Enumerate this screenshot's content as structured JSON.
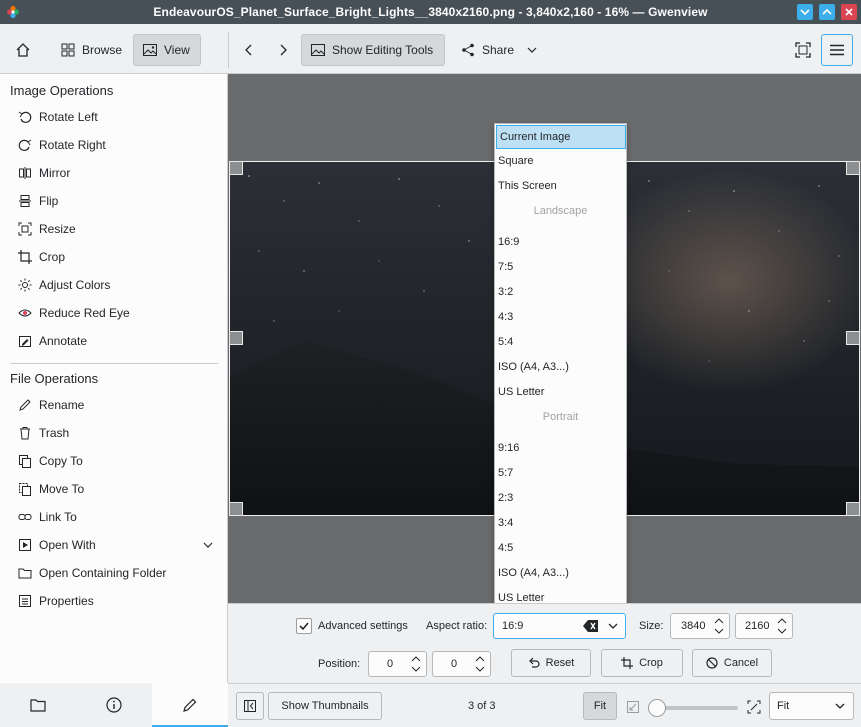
{
  "window": {
    "title": "EndeavourOS_Planet_Surface_Bright_Lights__3840x2160.png - 3,840x2,160 - 16% — Gwenview"
  },
  "toolbar": {
    "browse": "Browse",
    "view": "View",
    "show_editing_tools": "Show Editing Tools",
    "share": "Share"
  },
  "sidebar": {
    "image_ops_title": "Image Operations",
    "image_ops": [
      "Rotate Left",
      "Rotate Right",
      "Mirror",
      "Flip",
      "Resize",
      "Crop",
      "Adjust Colors",
      "Reduce Red Eye",
      "Annotate"
    ],
    "file_ops_title": "File Operations",
    "file_ops": [
      "Rename",
      "Trash",
      "Copy To",
      "Move To",
      "Link To",
      "Open With",
      "Open Containing Folder",
      "Properties"
    ]
  },
  "aspect_dropdown": {
    "items": [
      "Current Image",
      "Square",
      "This Screen",
      "Landscape",
      "16:9",
      "7:5",
      "3:2",
      "4:3",
      "5:4",
      "ISO (A4, A3...)",
      "US Letter",
      "Portrait",
      "9:16",
      "5:7",
      "2:3",
      "3:4",
      "4:5",
      "ISO (A4, A3...)",
      "US Letter"
    ],
    "selected": "Current Image"
  },
  "crop": {
    "advanced_settings": "Advanced settings",
    "advanced_checked": true,
    "aspect_ratio_label": "Aspect ratio:",
    "aspect_ratio_value": "16:9",
    "size_label": "Size:",
    "width": "3840",
    "height": "2160",
    "position_label": "Position:",
    "pos_x": "0",
    "pos_y": "0",
    "reset": "Reset",
    "crop": "Crop",
    "cancel": "Cancel"
  },
  "statusbar": {
    "show_thumbnails": "Show Thumbnails",
    "counter": "3 of 3",
    "fit_button": "Fit",
    "zoom_select": "Fit"
  },
  "colors": {
    "accent": "#3daee9",
    "titlebar": "#475057",
    "close": "#da4453"
  }
}
